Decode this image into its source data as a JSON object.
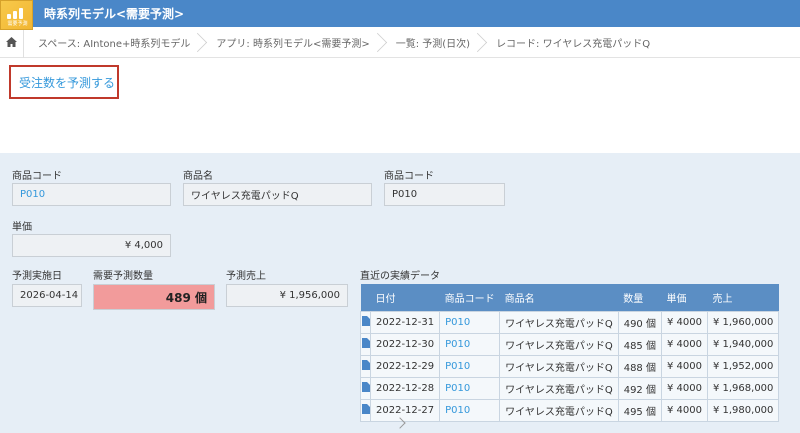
{
  "header": {
    "app_title": "時系列モデル<需要予測>",
    "icon_text": "需要予測",
    "icon_colors": {
      "bg": "#f7c94b",
      "fg": "#ffffff"
    },
    "bar_color": "#4a87c8"
  },
  "breadcrumb": {
    "home_icon": "home-icon",
    "items": [
      "スペース: AIntone+時系列モデル",
      "アプリ: 時系列モデル<需要予測>",
      "一覧: 予測(日次)",
      "レコード: ワイヤレス充電パッドQ"
    ]
  },
  "actions": {
    "forecast_button": "受注数を予測する"
  },
  "record": {
    "product_code_label": "商品コード",
    "product_code_value": "P010",
    "product_name_label": "商品名",
    "product_name_value": "ワイヤレス充電パッドQ",
    "product_code2_label": "商品コード",
    "product_code2_value": "P010",
    "unit_price_label": "単価",
    "unit_price_value": "¥ 4,000",
    "forecast_date_label": "予測実施日",
    "forecast_date_value": "2026-04-14",
    "forecast_qty_label": "需要予測数量",
    "forecast_qty_value": "489 個",
    "forecast_sales_label": "予測売上",
    "forecast_sales_value": "¥ 1,956,000",
    "recent_label": "直近の実績データ"
  },
  "table": {
    "headers": [
      "日付",
      "商品コード",
      "商品名",
      "数量",
      "単価",
      "売上"
    ],
    "rows": [
      [
        "2022-12-31",
        "P010",
        "ワイヤレス充電パッドQ",
        "490 個",
        "¥ 4000",
        "¥ 1,960,000"
      ],
      [
        "2022-12-30",
        "P010",
        "ワイヤレス充電パッドQ",
        "485 個",
        "¥ 4000",
        "¥ 1,940,000"
      ],
      [
        "2022-12-29",
        "P010",
        "ワイヤレス充電パッドQ",
        "488 個",
        "¥ 4000",
        "¥ 1,952,000"
      ],
      [
        "2022-12-28",
        "P010",
        "ワイヤレス充電パッドQ",
        "492 個",
        "¥ 4000",
        "¥ 1,968,000"
      ],
      [
        "2022-12-27",
        "P010",
        "ワイヤレス充電パッドQ",
        "495 個",
        "¥ 4000",
        "¥ 1,980,000"
      ]
    ]
  }
}
